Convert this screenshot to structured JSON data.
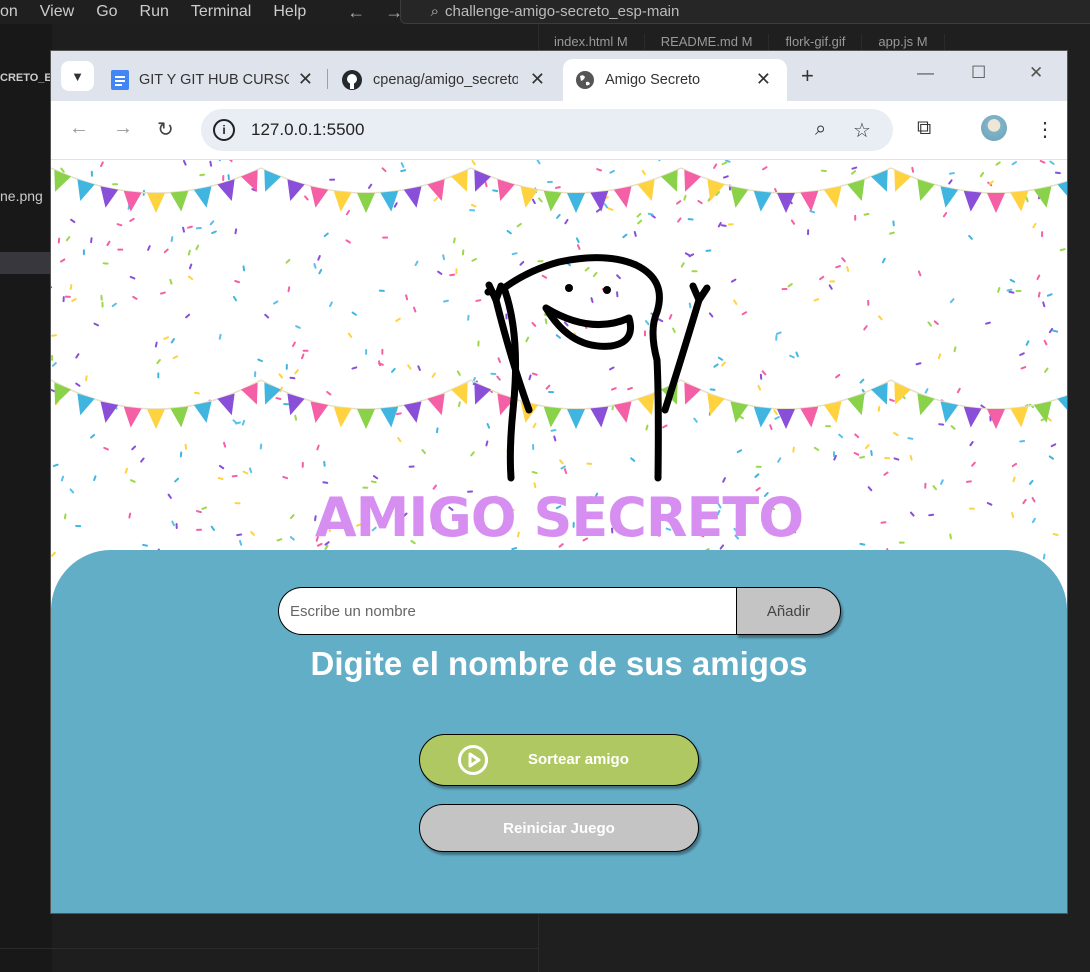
{
  "vscode": {
    "menu": [
      "on",
      "View",
      "Go",
      "Run",
      "Terminal",
      "Help"
    ],
    "search_text": "challenge-amigo-secreto_esp-main",
    "sidebar_texts": [
      "CRETO_E",
      "ne.png"
    ],
    "editor_tabs": [
      "index.html M",
      "README.md M",
      "flork-gif.gif",
      "app.js M"
    ]
  },
  "browser": {
    "tabs": [
      {
        "title": "GIT Y GIT HUB CURSO",
        "icon": "google-docs-icon"
      },
      {
        "title": "cpenag/amigo_secreto",
        "icon": "github-icon"
      },
      {
        "title": "Amigo Secreto",
        "icon": "globe-icon",
        "active": true
      }
    ],
    "url": "127.0.0.1:5500"
  },
  "page": {
    "title": "AMIGO SECRETO",
    "input_placeholder": "Escribe un nombre",
    "add_label": "Añadir",
    "subtitle": "Digite el nombre de sus amigos",
    "draw_label": "Sortear amigo",
    "reset_label": "Reiniciar Juego"
  },
  "colors": {
    "title": "#d68ff0",
    "panel": "#63aec7",
    "draw_button": "#b0c862",
    "gray_button": "#c4c4c4"
  }
}
